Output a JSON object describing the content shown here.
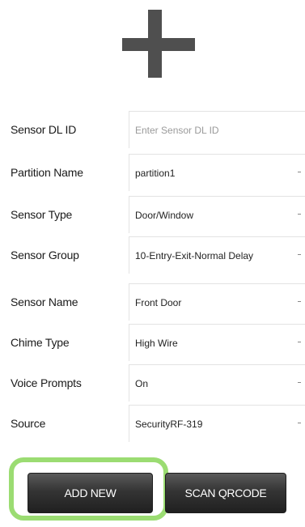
{
  "header": {
    "add_icon": "plus-icon",
    "icon_color": "#4f4f4f"
  },
  "form": {
    "fields": [
      {
        "label": "Sensor DL ID",
        "value": "",
        "placeholder": "Enter Sensor DL ID",
        "kind": "text"
      },
      {
        "label": "Partition Name",
        "value": "partition1",
        "kind": "select"
      },
      {
        "label": "Sensor Type",
        "value": "Door/Window",
        "kind": "select"
      },
      {
        "label": "Sensor Group",
        "value": "10-Entry-Exit-Normal Delay",
        "kind": "select"
      },
      {
        "label": "Sensor Name",
        "value": "Front Door",
        "kind": "select"
      },
      {
        "label": "Chime Type",
        "value": "High Wire",
        "kind": "select"
      },
      {
        "label": "Voice Prompts",
        "value": "On",
        "kind": "select"
      },
      {
        "label": "Source",
        "value": "SecurityRF-319",
        "kind": "select"
      }
    ]
  },
  "actions": {
    "add_new_label": "ADD NEW",
    "scan_qrcode_label": "SCAN QRCODE",
    "highlight_color": "#9bdc72"
  }
}
